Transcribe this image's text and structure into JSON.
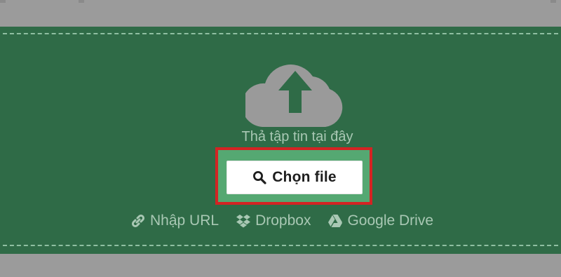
{
  "upload": {
    "drop_text": "Thả tập tin tại đây",
    "choose_button_label": "Chọn file"
  },
  "sources": [
    {
      "label": "Nhập URL",
      "icon": "link-icon"
    },
    {
      "label": "Dropbox",
      "icon": "dropbox-icon"
    },
    {
      "label": "Google Drive",
      "icon": "google-drive-icon"
    }
  ],
  "colors": {
    "panel_background": "#2f6b47",
    "page_background": "#9b9b9b",
    "dashed_border": "#8fbfa1",
    "cloud_icon": "#9a9a9a",
    "highlight_frame": "#d42323",
    "button_background": "#ffffff"
  }
}
